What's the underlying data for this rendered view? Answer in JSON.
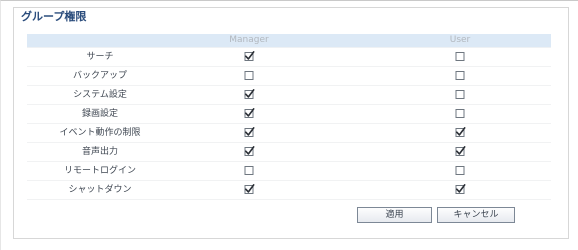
{
  "title": "グループ権限",
  "columns": [
    "Manager",
    "User"
  ],
  "rows": [
    {
      "label": "サーチ",
      "manager": true,
      "user": false
    },
    {
      "label": "バックアップ",
      "manager": false,
      "user": false
    },
    {
      "label": "システム設定",
      "manager": true,
      "user": false
    },
    {
      "label": "録画設定",
      "manager": true,
      "user": false
    },
    {
      "label": "イベント動作の制限",
      "manager": true,
      "user": true
    },
    {
      "label": "音声出力",
      "manager": true,
      "user": true
    },
    {
      "label": "リモートログイン",
      "manager": false,
      "user": false
    },
    {
      "label": "シャットダウン",
      "manager": true,
      "user": true
    }
  ],
  "buttons": {
    "apply": "適用",
    "cancel": "キャンセル"
  },
  "colors": {
    "title": "#2a4c7c",
    "header_bg": "#dce9f6",
    "checkmark": "#2b2f36"
  }
}
